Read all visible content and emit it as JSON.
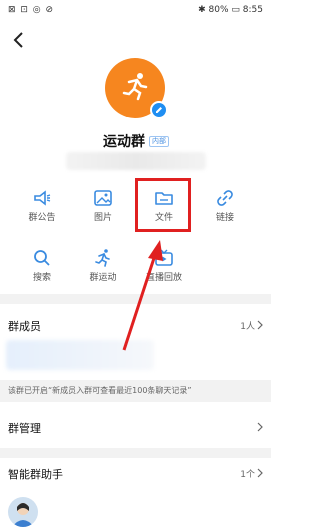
{
  "status_bar": {
    "left_icons": "⊠ ⊡ ◎ ⊘",
    "right": "✱ 80% ▭ 8:55"
  },
  "group": {
    "name": "运动群",
    "tag": "内部"
  },
  "grid": [
    {
      "label": "群公告",
      "icon": "announcement-icon"
    },
    {
      "label": "图片",
      "icon": "image-icon"
    },
    {
      "label": "文件",
      "icon": "folder-icon"
    },
    {
      "label": "链接",
      "icon": "link-icon"
    },
    {
      "label": "搜索",
      "icon": "search-icon"
    },
    {
      "label": "群运动",
      "icon": "running-icon"
    },
    {
      "label": "直播回放",
      "icon": "tv-icon"
    }
  ],
  "members": {
    "title": "群成员",
    "count": "1人"
  },
  "notice": "该群已开启“新成员入群可查看最近100条聊天记录”",
  "manage": {
    "title": "群管理"
  },
  "assistant": {
    "title": "智能群助手",
    "count": "1个"
  },
  "colors": {
    "accent": "#1f8ef2",
    "avatar": "#f6861f",
    "highlight": "#e02020"
  }
}
